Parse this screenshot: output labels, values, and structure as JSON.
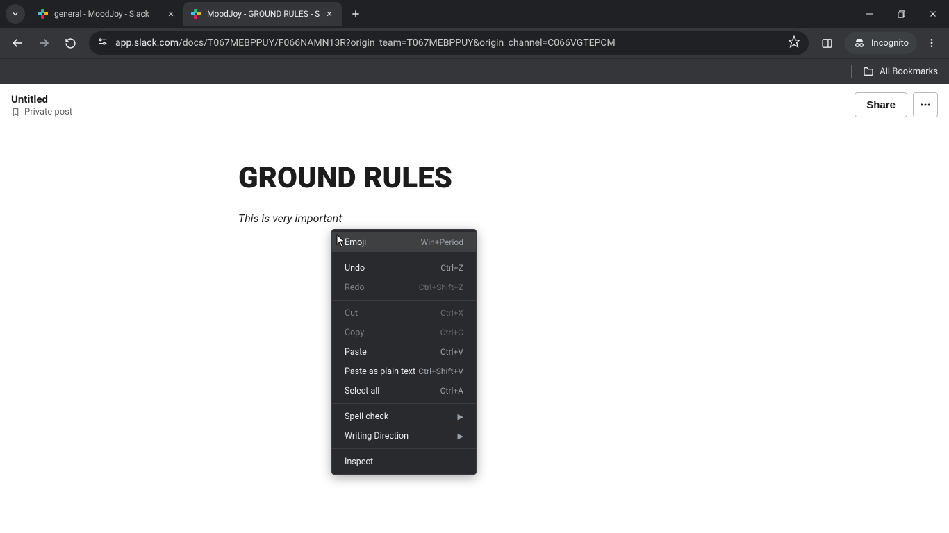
{
  "browser": {
    "tabs": [
      {
        "title": "general - MoodJoy - Slack"
      },
      {
        "title": "MoodJoy - GROUND RULES - S"
      }
    ],
    "url_host": "app.slack.com",
    "url_path": "/docs/T067MEBPPUY/F066NAMN13R?origin_team=T067MEBPPUY&origin_channel=C066VGTEPCM",
    "incognito_label": "Incognito",
    "all_bookmarks": "All Bookmarks"
  },
  "header": {
    "doc_title": "Untitled",
    "doc_visibility": "Private post",
    "share_label": "Share"
  },
  "document": {
    "heading": "GROUND RULES",
    "paragraph": "This is very important"
  },
  "context_menu": {
    "emoji": {
      "label": "Emoji",
      "shortcut": "Win+Period"
    },
    "undo": {
      "label": "Undo",
      "shortcut": "Ctrl+Z"
    },
    "redo": {
      "label": "Redo",
      "shortcut": "Ctrl+Shift+Z"
    },
    "cut": {
      "label": "Cut",
      "shortcut": "Ctrl+X"
    },
    "copy": {
      "label": "Copy",
      "shortcut": "Ctrl+C"
    },
    "paste": {
      "label": "Paste",
      "shortcut": "Ctrl+V"
    },
    "paste_plain": {
      "label": "Paste as plain text",
      "shortcut": "Ctrl+Shift+V"
    },
    "select_all": {
      "label": "Select all",
      "shortcut": "Ctrl+A"
    },
    "spell_check": {
      "label": "Spell check"
    },
    "writing_direction": {
      "label": "Writing Direction"
    },
    "inspect": {
      "label": "Inspect"
    }
  }
}
